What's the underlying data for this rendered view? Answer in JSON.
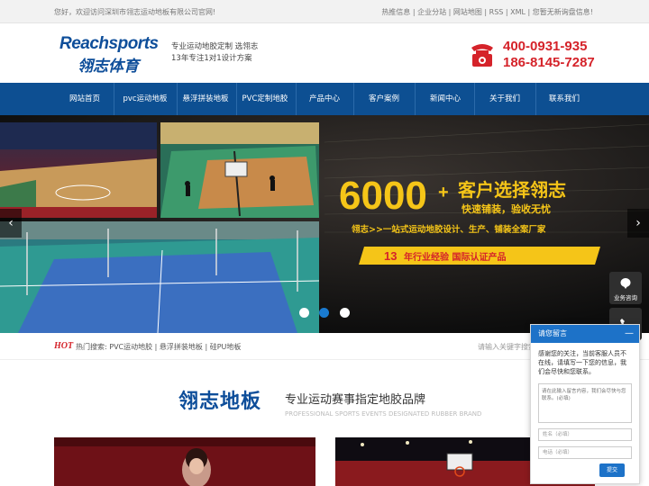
{
  "topbar": {
    "welcome": "您好，欢迎访问深圳市翎志运动地板有限公司官网!",
    "links": [
      "热推信息",
      "企业分站",
      "网站地图",
      "RSS",
      "XML",
      "您暂无新询盘信息!"
    ]
  },
  "header": {
    "logo_en": "Reachsports",
    "logo_cn": "翎志体育",
    "slogan_line1": "专业运动地胶定制 选翎志",
    "slogan_line2": "13年专注1对1设计方案",
    "phone1": "400-0931-935",
    "phone2": "186-8145-7287"
  },
  "nav": {
    "items": [
      "网站首页",
      "pvc运动地板",
      "悬浮拼装地板",
      "PVC定制地胶",
      "产品中心",
      "客户案例",
      "新闻中心",
      "关于我们",
      "联系我们"
    ]
  },
  "hero": {
    "big_number": "6000",
    "plus": "+",
    "headline": "客户选择翎志",
    "subhead": "快速铺装，验收无忧",
    "line": "翎志>>一站式运动地胶设计、生产、铺装全案厂家",
    "ribbon_num": "13",
    "ribbon_text": "年行业经验  国际认证产品",
    "prev": "‹",
    "next": "›"
  },
  "hot": {
    "label": "HOT",
    "prefix": "热门搜索:",
    "terms": [
      "PVC运动地胶",
      "悬浮拼装地板",
      "硅PU地板"
    ],
    "search_placeholder": "请输入关键字搜索"
  },
  "section": {
    "title": "翎志地板",
    "subtitle": "专业运动赛事指定地胶品牌",
    "subtitle_en": "PROFESSIONAL SPORTS EVENTS DESIGNATED RUBBER BRAND"
  },
  "tools": {
    "consult": "业务咨询"
  },
  "chat": {
    "title": "请您留言",
    "min": "—",
    "message": "感谢您的关注，当前客服人员不在线，请填写一下您的信息，我们会尽快和您联系。",
    "textarea_placeholder": "请在此输入留言内容，我们会尽快与您联系。(必填)",
    "name_placeholder": "姓名（必填）",
    "phone_placeholder": "电话（必填）",
    "submit": "提交"
  },
  "colors": {
    "brand_blue": "#0d4f92",
    "accent_red": "#d5232a",
    "gold": "#f5c518"
  }
}
